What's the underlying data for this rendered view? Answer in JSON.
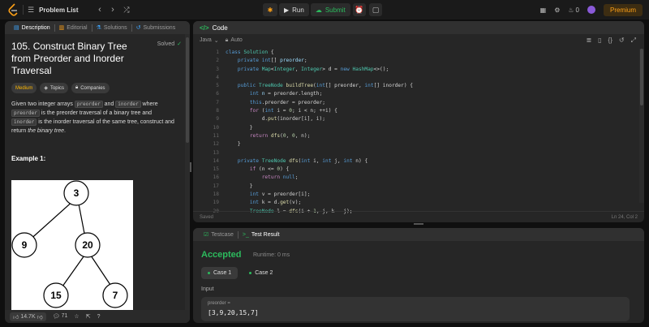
{
  "topbar": {
    "problem_list": "Problem List",
    "run": "Run",
    "submit": "Submit",
    "streak": "0",
    "premium": "Premium",
    "accent": "#ffa116"
  },
  "left": {
    "tabs": [
      "Description",
      "Editorial",
      "Solutions",
      "Submissions"
    ],
    "title": "105. Construct Binary Tree from Preorder and Inorder Traversal",
    "solved": "Solved",
    "badges": [
      "Medium",
      "Topics",
      "Companies"
    ],
    "para": {
      "p1": "Given two integer arrays ",
      "c1": "preorder",
      "p2": " and ",
      "c2": "inorder",
      "p3": " where ",
      "c3": "preorder",
      "p4": " is the preorder traversal of a binary tree and ",
      "c4": "inorder",
      "p5": " is the inorder traversal of the same tree, construct and return ",
      "em": "the binary tree",
      "p6": "."
    },
    "example": "Example 1:",
    "tree_nodes": [
      "3",
      "9",
      "20",
      "15",
      "7"
    ],
    "likes": "14.7K",
    "comments": "71"
  },
  "code": {
    "tab": "Code",
    "language": "Java",
    "mode": "Auto",
    "status_left": "Saved",
    "status_right": "Ln 24, Col 2",
    "line_numbers": [
      "1",
      "2",
      "3",
      "4",
      "5",
      "6",
      "7",
      "8",
      "9",
      "10",
      "11",
      "12",
      "13",
      "14",
      "15",
      "16",
      "17",
      "18",
      "19",
      "20"
    ]
  },
  "test": {
    "tab1": "Testcase",
    "tab2": "Test Result",
    "verdict": "Accepted",
    "runtime": "Runtime: 0 ms",
    "cases": [
      "Case 1",
      "Case 2"
    ],
    "input_label": "Input",
    "param_name": "preorder =",
    "param_value": "[3,9,20,15,7]"
  }
}
